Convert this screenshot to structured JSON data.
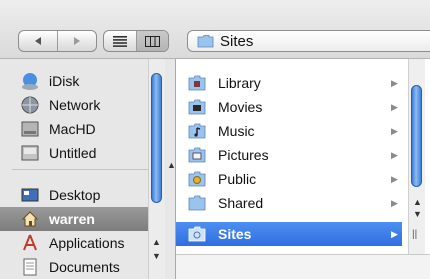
{
  "toolbar": {
    "back_icon": "triangle-left-icon",
    "forward_icon": "triangle-right-icon",
    "list_view_icon": "list-view-icon",
    "column_view_icon": "column-view-icon",
    "path": {
      "icon": "folder-icon",
      "label": "Sites"
    }
  },
  "sidebar": {
    "items": [
      {
        "label": "iDisk",
        "icon": "idisk-icon"
      },
      {
        "label": "Network",
        "icon": "network-globe-icon"
      },
      {
        "label": "MacHD",
        "icon": "hard-drive-icon"
      },
      {
        "label": "Untitled",
        "icon": "disk-icon"
      },
      {
        "label": "Desktop",
        "icon": "desktop-icon"
      },
      {
        "label": "warren",
        "icon": "home-icon",
        "selected": true
      },
      {
        "label": "Applications",
        "icon": "applications-icon"
      },
      {
        "label": "Documents",
        "icon": "documents-icon"
      }
    ]
  },
  "column": {
    "items": [
      {
        "label": "Library",
        "icon": "library-folder-icon"
      },
      {
        "label": "Movies",
        "icon": "movies-folder-icon"
      },
      {
        "label": "Music",
        "icon": "music-folder-icon"
      },
      {
        "label": "Pictures",
        "icon": "pictures-folder-icon"
      },
      {
        "label": "Public",
        "icon": "public-folder-icon"
      },
      {
        "label": "Shared",
        "icon": "folder-icon"
      },
      {
        "label": "Sites",
        "icon": "sites-folder-icon",
        "selected": true
      }
    ]
  },
  "colors": {
    "selection_blue": "#3a78e4",
    "selection_gray": "#8a8a8a"
  }
}
